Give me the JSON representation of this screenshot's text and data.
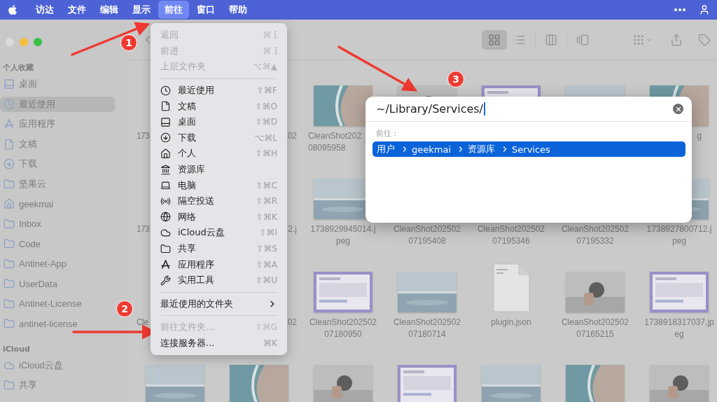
{
  "menubar": {
    "items": [
      {
        "label": "访达",
        "selected": false
      },
      {
        "label": "文件",
        "selected": false
      },
      {
        "label": "编辑",
        "selected": false
      },
      {
        "label": "显示",
        "selected": false
      },
      {
        "label": "前往",
        "selected": true
      },
      {
        "label": "窗口",
        "selected": false
      },
      {
        "label": "帮助",
        "selected": false
      }
    ]
  },
  "sidebar": {
    "sections": [
      {
        "title": "个人收藏",
        "items": [
          {
            "label": "桌面",
            "selected": false
          },
          {
            "label": "最近使用",
            "selected": true
          },
          {
            "label": "应用程序",
            "selected": false
          },
          {
            "label": "文稿",
            "selected": false
          },
          {
            "label": "下载",
            "selected": false
          },
          {
            "label": "坚果云",
            "selected": false
          },
          {
            "label": "geekmai",
            "selected": false
          },
          {
            "label": "Inbox",
            "selected": false
          },
          {
            "label": "Code",
            "selected": false
          },
          {
            "label": "Antinet-App",
            "selected": false
          },
          {
            "label": "UserData",
            "selected": false
          },
          {
            "label": "Antinet-License",
            "selected": false
          },
          {
            "label": "antinet-license",
            "selected": false
          }
        ]
      },
      {
        "title": "iCloud",
        "items": [
          {
            "label": "iCloud云盘",
            "selected": false
          },
          {
            "label": "共享",
            "selected": false
          }
        ]
      }
    ]
  },
  "toolbar": {
    "views": [
      {
        "selected": true
      },
      {
        "selected": false
      },
      {
        "selected": false
      },
      {
        "selected": false
      }
    ]
  },
  "grid": {
    "rows": [
      [
        {
          "kind": "none",
          "label": [
            "173"
          ],
          "cut_end": true
        },
        {
          "kind": "none",
          "label": [
            "02"
          ],
          "cut_start": true
        },
        {
          "kind": "picture",
          "label": [
            "CleanShot202",
            "08095958"
          ],
          "cut_end": true
        },
        {
          "kind": "picture"
        },
        {
          "kind": "picture"
        },
        {
          "kind": "picture"
        },
        {
          "kind": "picture",
          "label": [
            "g"
          ],
          "cut_start": true
        }
      ],
      [
        {
          "kind": "none",
          "label": [
            "173"
          ],
          "cut_end": true
        },
        {
          "kind": "none",
          "label": [
            "2.j"
          ],
          "cut_start": true
        },
        {
          "kind": "picture",
          "label": [
            "1738929945014.j",
            "peg"
          ]
        },
        {
          "kind": "none",
          "label": [
            "CleanShot202502",
            "07195408"
          ]
        },
        {
          "kind": "none",
          "label": [
            "CleanShot202502",
            "07195346"
          ]
        },
        {
          "kind": "none",
          "label": [
            "CleanShot202502",
            "07195332"
          ]
        },
        {
          "kind": "picture",
          "label": [
            "1738927800712.j",
            "peg"
          ]
        }
      ],
      [
        {
          "kind": "none",
          "label": [
            "Cle"
          ],
          "cut_end": true
        },
        {
          "kind": "none",
          "label": [
            "02"
          ],
          "cut_start": true
        },
        {
          "kind": "picture",
          "label": [
            "CleanShot202502",
            "07180950"
          ]
        },
        {
          "kind": "picture",
          "label": [
            "CleanShot202502",
            "07180714"
          ]
        },
        {
          "kind": "file",
          "label": [
            "plugin.json"
          ]
        },
        {
          "kind": "picture",
          "label": [
            "CleanShot202502",
            "07165215"
          ]
        },
        {
          "kind": "picture",
          "label": [
            "1738918317037.jp",
            "eg"
          ]
        }
      ],
      [
        {
          "kind": "picture"
        },
        {
          "kind": "picture"
        },
        {
          "kind": "picture"
        },
        {
          "kind": "picture"
        },
        {
          "kind": "picture"
        },
        {
          "kind": "picture"
        },
        {
          "kind": "picture"
        }
      ]
    ]
  },
  "menu": {
    "items": [
      {
        "kind": "plain",
        "label": "返回",
        "shortcut": "⌘ [",
        "disabled": true
      },
      {
        "kind": "plain",
        "label": "前进",
        "shortcut": "⌘ ]",
        "disabled": true
      },
      {
        "kind": "plain",
        "label": "上层文件夹",
        "shortcut": "⌥⌘▲",
        "disabled": true
      },
      {
        "kind": "separator"
      },
      {
        "kind": "icon",
        "label": "最近使用",
        "shortcut": "⇧⌘F",
        "disabled": false
      },
      {
        "kind": "icon",
        "label": "文稿",
        "shortcut": "⇧⌘O",
        "disabled": false
      },
      {
        "kind": "icon",
        "label": "桌面",
        "shortcut": "⇧⌘D",
        "disabled": false
      },
      {
        "kind": "icon",
        "label": "下载",
        "shortcut": "⌥⌘L",
        "disabled": false
      },
      {
        "kind": "icon",
        "label": "个人",
        "shortcut": "⇧⌘H",
        "disabled": false
      },
      {
        "kind": "icon",
        "label": "资源库",
        "disabled": false
      },
      {
        "kind": "icon",
        "label": "电脑",
        "shortcut": "⇧⌘C",
        "disabled": false
      },
      {
        "kind": "icon",
        "label": "隔空投送",
        "shortcut": "⇧⌘R",
        "disabled": false
      },
      {
        "kind": "icon",
        "label": "网络",
        "shortcut": "⇧⌘K",
        "disabled": false
      },
      {
        "kind": "icon",
        "label": "iCloud云盘",
        "shortcut": "⇧⌘I",
        "disabled": false
      },
      {
        "kind": "icon",
        "label": "共享",
        "shortcut": "⇧⌘S",
        "disabled": false
      },
      {
        "kind": "icon",
        "label": "应用程序",
        "shortcut": "⇧⌘A",
        "disabled": false
      },
      {
        "kind": "icon",
        "label": "实用工具",
        "shortcut": "⇧⌘U",
        "disabled": false
      },
      {
        "kind": "separator"
      },
      {
        "kind": "submenu",
        "label": "最近使用的文件夹",
        "disabled": false
      },
      {
        "kind": "separator"
      },
      {
        "kind": "plain",
        "label": "前往文件夹...",
        "shortcut": "⇧⌘G",
        "disabled": true
      },
      {
        "kind": "plain",
        "label": "连接服务器...",
        "shortcut": "⌘K",
        "disabled": false
      }
    ]
  },
  "dialog": {
    "path": "~/Library/Services/",
    "label": "前往：",
    "results": [
      {
        "segments": [
          "用户",
          "geekmai",
          "资源库",
          "Services"
        ],
        "selected": true
      }
    ]
  },
  "annotations": [
    {
      "label": "1"
    },
    {
      "label": "2"
    },
    {
      "label": "3"
    }
  ]
}
